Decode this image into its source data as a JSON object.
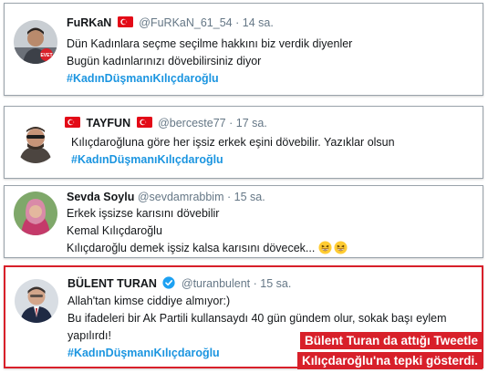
{
  "colors": {
    "hashtag": "#1b95e0",
    "handle": "#657786",
    "highlight_border": "#d8202a",
    "caption_bg": "#d8202a",
    "verified": "#1da1f2"
  },
  "tweets": [
    {
      "name": "FuRKaN",
      "handle": "@FuRKaN_61_54",
      "dot": "·",
      "time": "14 sa.",
      "has_flag": true,
      "lines": [
        "Dün Kadınlara seçme seçilme hakkını biz verdik diyenler",
        "Bugün kadınlarınızı dövebilirsiniz diyor"
      ],
      "hashtag": "#KadınDüşmanıKılıçdaroğlu"
    },
    {
      "name": "TAYFUN",
      "handle": "@berceste77",
      "dot": "·",
      "time": "17 sa.",
      "has_flag": true,
      "lines": [
        "Kılıçdaroğluna göre her işsiz erkek eşini dövebilir. Yazıklar olsun"
      ],
      "hashtag": "#KadınDüşmanıKılıçdaroğlu"
    },
    {
      "name": "Sevda Soylu",
      "handle": "@sevdamrabbim",
      "dot": "·",
      "time": "15 sa.",
      "has_flag": false,
      "lines": [
        "Erkek işsizse karısını dövebilir",
        "Kemal Kılıçdaroğlu",
        "Kılıçdaroğlu demek işsiz kalsa karısını dövecek..."
      ],
      "emojis": [
        "grinning-squint-face-icon",
        "grinning-squint-face-icon"
      ]
    },
    {
      "name": "BÜLENT TURAN",
      "handle": "@turanbulent",
      "dot": "·",
      "time": "15 sa.",
      "verified": true,
      "lines": [
        "Allah'tan kimse ciddiye almıyor:)",
        "Bu ifadeleri bir Ak Partili kullansaydı 40 gün gündem olur, sokak başı eylem",
        "yapılırdı!"
      ],
      "hashtag": "#KadınDüşmanıKılıçdaroğlu"
    }
  ],
  "caption": {
    "line1": "Bülent Turan da attığı Tweetle",
    "line2": "Kılıçdaroğlu'na tepki gösterdi."
  }
}
